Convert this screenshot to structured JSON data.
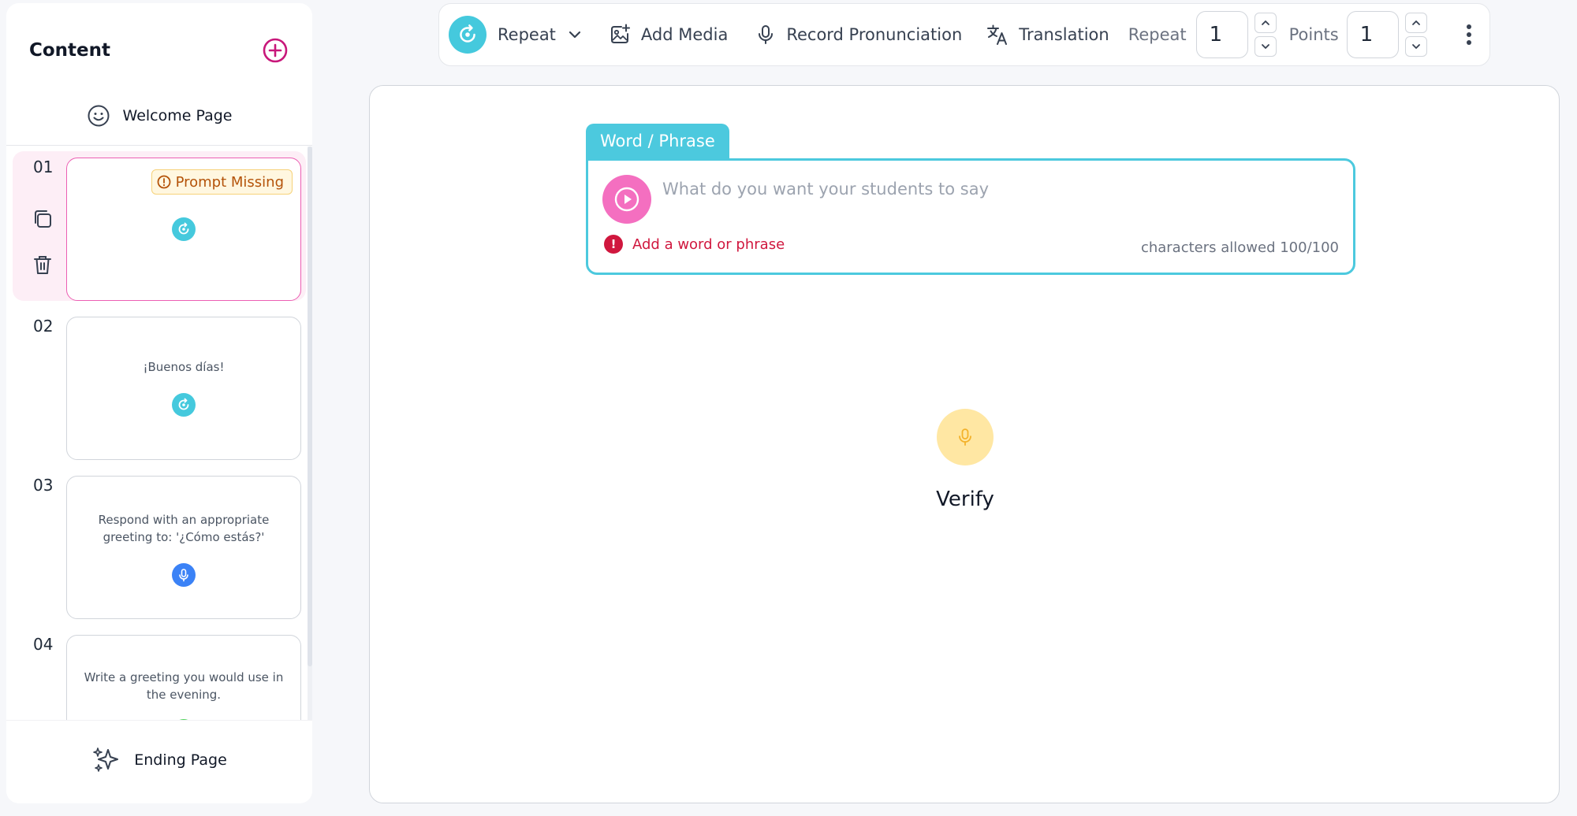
{
  "sidebar": {
    "title": "Content",
    "welcome_label": "Welcome Page",
    "ending_label": "Ending Page",
    "slides": [
      {
        "number": "01",
        "text": "",
        "badge": "Prompt Missing",
        "type_icon": "repeat-icon",
        "type_color": "#45c9dd"
      },
      {
        "number": "02",
        "text": "¡Buenos días!",
        "type_icon": "repeat-icon",
        "type_color": "#45c9dd"
      },
      {
        "number": "03",
        "text": "Respond with an appropriate greeting to: '¿Cómo estás?'",
        "type_icon": "mic-icon",
        "type_color": "#3b82f6"
      },
      {
        "number": "04",
        "text": "Write a greeting you would use in the evening.",
        "type_icon": "check-icon",
        "type_color": "#4fd35a"
      }
    ]
  },
  "toolbar": {
    "type_label": "Repeat",
    "add_media_label": "Add Media",
    "record_label": "Record Pronunciation",
    "translation_label": "Translation",
    "repeat_label": "Repeat",
    "repeat_value": "1",
    "points_label": "Points",
    "points_value": "1"
  },
  "editor": {
    "tab_label": "Word / Phrase",
    "placeholder": "What do you want your students to say",
    "value": "",
    "error": "Add a word or phrase",
    "char_count": "characters allowed 100/100",
    "verify_label": "Verify"
  },
  "colors": {
    "accent_cyan": "#4cc9de",
    "accent_pink": "#f46fc0",
    "brand_magenta": "#c8177a",
    "error_red": "#d0173e",
    "warning_bg": "#fff7e0",
    "verify_yellow": "#ffe7a3"
  }
}
